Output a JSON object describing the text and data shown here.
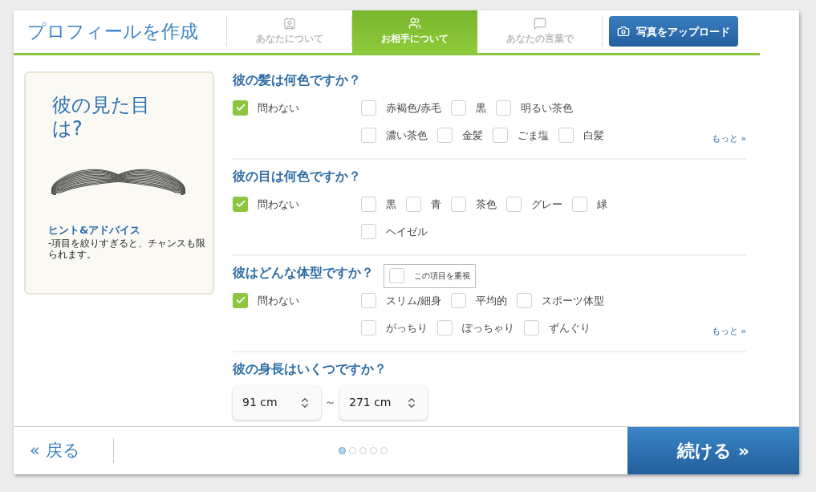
{
  "header": {
    "title": "プロフィールを作成",
    "tabs": [
      {
        "label": "あなたについて",
        "kind": "card",
        "selected": false
      },
      {
        "label": "お相手について",
        "kind": "people",
        "selected": true
      },
      {
        "label": "あなたの言葉で",
        "kind": "speech",
        "selected": false
      }
    ],
    "upload_button": "写真をアップロード"
  },
  "sidebar": {
    "heading": "彼の見た目は?",
    "hint_title": "ヒント&アドバイス",
    "hint_text": "-項目を絞りすぎると、チャンスも限られます。"
  },
  "questions": [
    {
      "kind": "checks",
      "title": "彼の髪は何色ですか？",
      "any": {
        "label": "問わない",
        "checked": true
      },
      "rows": [
        [
          {
            "label": "赤褐色/赤毛",
            "checked": false
          },
          {
            "label": "黒",
            "checked": false
          },
          {
            "label": "明るい茶色",
            "checked": false
          }
        ],
        [
          {
            "label": "濃い茶色",
            "checked": false
          },
          {
            "label": "金髪",
            "checked": false
          },
          {
            "label": "ごま塩",
            "checked": false
          },
          {
            "label": "白髪",
            "checked": false
          }
        ]
      ],
      "more": "もっと »"
    },
    {
      "kind": "checks",
      "title": "彼の目は何色ですか？",
      "any": {
        "label": "問わない",
        "checked": true
      },
      "rows": [
        [
          {
            "label": "黒",
            "checked": false
          },
          {
            "label": "青",
            "checked": false
          },
          {
            "label": "茶色",
            "checked": false
          },
          {
            "label": "グレー",
            "checked": false
          },
          {
            "label": "緑",
            "checked": false
          }
        ],
        [
          {
            "label": "ヘイゼル",
            "checked": false
          }
        ]
      ]
    },
    {
      "kind": "checks",
      "title": "彼はどんな体型ですか？",
      "priority": {
        "label": "この項目を重視",
        "checked": false
      },
      "any": {
        "label": "問わない",
        "checked": true
      },
      "rows": [
        [
          {
            "label": "スリム/細身",
            "checked": false
          },
          {
            "label": "平均的",
            "checked": false
          },
          {
            "label": "スポーツ体型",
            "checked": false
          }
        ],
        [
          {
            "label": "がっちり",
            "checked": false
          },
          {
            "label": "ぽっちゃり",
            "checked": false
          },
          {
            "label": "ずんぐり",
            "checked": false
          }
        ]
      ],
      "more": "もっと »"
    },
    {
      "kind": "range",
      "title": "彼の身長はいくつですか？",
      "from": "91 cm",
      "separator": "～",
      "to": "271 cm"
    }
  ],
  "footer": {
    "back": "« 戻る",
    "pages": [
      {
        "selected": true
      },
      {
        "selected": false
      },
      {
        "selected": false
      },
      {
        "selected": false
      },
      {
        "selected": false
      }
    ],
    "next": "続ける »"
  }
}
